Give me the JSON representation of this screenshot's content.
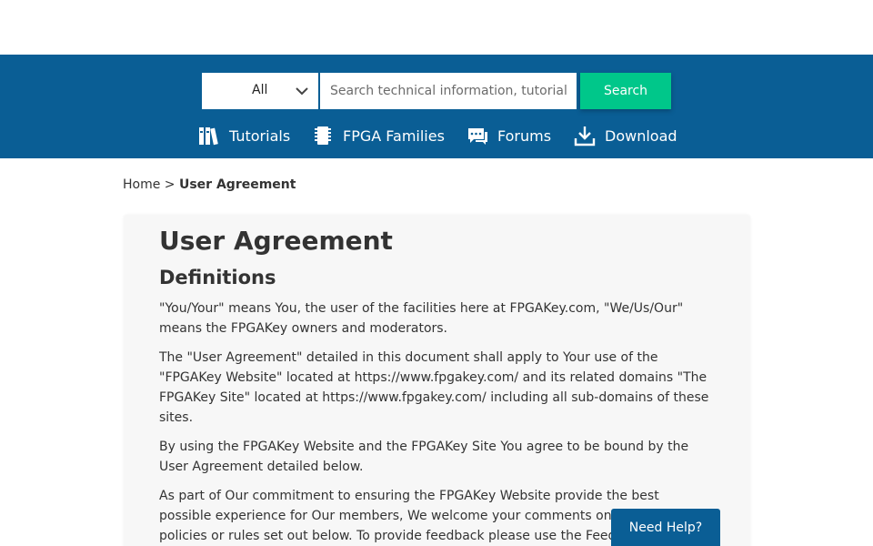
{
  "colors": {
    "header_blue": "#0a5e95",
    "search_green": "#00c78a",
    "card_bg": "#f7f7f7",
    "text": "#333333"
  },
  "search": {
    "scope_value": "All",
    "placeholder": "Search technical information, tutorial, etc.",
    "button_label": "Search"
  },
  "nav": {
    "tutorials": {
      "label": "Tutorials",
      "icon": "books-icon"
    },
    "fpga_families": {
      "label": "FPGA Families",
      "icon": "chip-icon"
    },
    "forums": {
      "label": "Forums",
      "icon": "chat-icon"
    },
    "download": {
      "label": "Download",
      "icon": "download-icon"
    }
  },
  "breadcrumb": {
    "home": "Home",
    "separator": ">",
    "current": "User Agreement"
  },
  "content": {
    "title": "User Agreement",
    "section_title": "Definitions",
    "paragraphs": [
      "\"You/Your\" means You, the user of the facilities here at FPGAKey.com, \"We/Us/Our\" means the FPGAKey owners and moderators.",
      "The \"User Agreement\" detailed in this document shall apply to Your use of the \"FPGAKey Website\" located at https://www.fpgakey.com/ and its related domains \"The FPGAKey Site\" located at https://www.fpgakey.com/ including all sub-domains of these sites.",
      "By using the FPGAKey Website and the FPGAKey Site You agree to be bound by the User Agreement detailed below.",
      "As part of Our commitment to ensuring the FPGAKey Website provide the best possible experience for Our members, We welcome your comments on any of the policies or rules set out below. To provide feedback please use the Feedback"
    ]
  },
  "help_button": "Need Help?"
}
